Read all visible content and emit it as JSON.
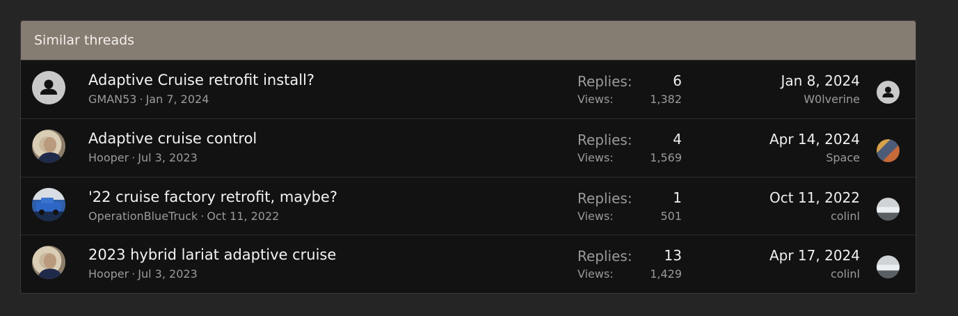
{
  "header": {
    "title": "Similar threads"
  },
  "threads": [
    {
      "title": "Adaptive Cruise retrofit install?",
      "author": "GMAN53",
      "started": "Jan 7, 2024",
      "replies_label": "Replies:",
      "replies": "6",
      "views_label": "Views:",
      "views": "1,382",
      "last_date": "Jan 8, 2024",
      "last_user": "W0lverine",
      "avatar": "default-person-icon",
      "last_avatar": "default-person-icon"
    },
    {
      "title": "Adaptive cruise control",
      "author": "Hooper",
      "started": "Jul 3, 2023",
      "replies_label": "Replies:",
      "replies": "4",
      "views_label": "Views:",
      "views": "1,569",
      "last_date": "Apr 14, 2024",
      "last_user": "Space",
      "avatar": "user-photo",
      "last_avatar": "user-photo"
    },
    {
      "title": "'22 cruise factory retrofit, maybe?",
      "author": "OperationBlueTruck",
      "started": "Oct 11, 2022",
      "replies_label": "Replies:",
      "replies": "1",
      "views_label": "Views:",
      "views": "501",
      "last_date": "Oct 11, 2022",
      "last_user": "colinl",
      "avatar": "user-photo",
      "last_avatar": "user-photo"
    },
    {
      "title": "2023 hybrid lariat adaptive cruise",
      "author": "Hooper",
      "started": "Jul 3, 2023",
      "replies_label": "Replies:",
      "replies": "13",
      "views_label": "Views:",
      "views": "1,429",
      "last_date": "Apr 17, 2024",
      "last_user": "colinl",
      "avatar": "user-photo",
      "last_avatar": "user-photo"
    }
  ],
  "meta_separator": "·",
  "colors": {
    "page_bg": "#252525",
    "block_bg": "#121212",
    "header_bg": "#857c72",
    "muted_text": "#9b9b9b"
  }
}
